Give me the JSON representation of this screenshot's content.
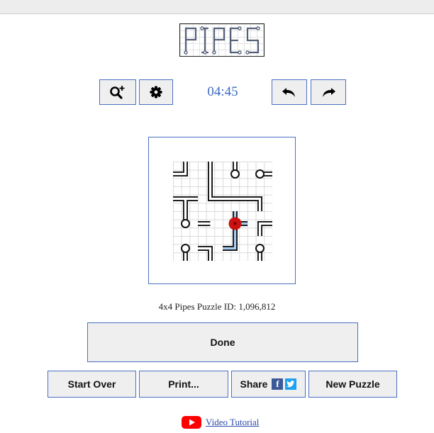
{
  "logo": {
    "text": "PIPES"
  },
  "toolbar": {
    "zoom_icon": "zoom-in-icon",
    "settings_icon": "gear-icon",
    "timer": "04:45",
    "undo_icon": "undo-arrow-icon",
    "redo_icon": "redo-arrow-icon"
  },
  "puzzle": {
    "grid_size": "4x4",
    "caption": "4x4 Pipes Puzzle ID: 1,096,812",
    "source_color": "#cc1111",
    "connected_pipe_color": "#a8ccf0",
    "pipe_outline_color": "#111111"
  },
  "buttons": {
    "done": "Done",
    "start_over": "Start Over",
    "print": "Print...",
    "share": "Share",
    "facebook_glyph": "f",
    "new_puzzle": "New Puzzle"
  },
  "social_colors": {
    "facebook": "#3b5998",
    "twitter": "#1da1f2"
  },
  "footer": {
    "video_tutorial": "Video Tutorial",
    "youtube_color": "#ff0000"
  }
}
